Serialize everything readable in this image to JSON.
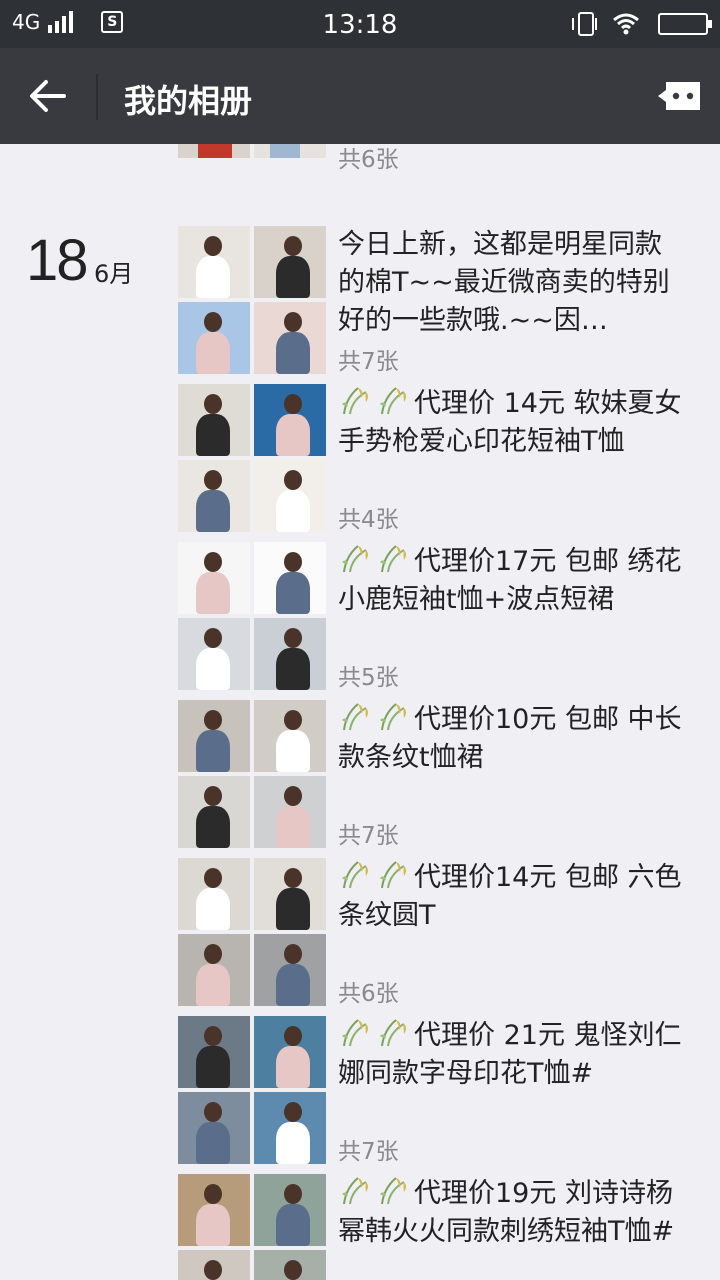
{
  "status_bar": {
    "network": "4G",
    "time": "13:18",
    "sim_badge": "S"
  },
  "app_bar": {
    "title": "我的相册",
    "back_icon": "arrow-left-icon",
    "more_icon": "message-dots-icon"
  },
  "partial_top_post": {
    "count": "共6张"
  },
  "date_group": {
    "day": "18",
    "month": "6月"
  },
  "posts": [
    {
      "caption": "今日上新，这都是明星同款的棉T~~最近微商卖的特别好的一些款哦.~~因…",
      "count": "共7张",
      "has_leaf_icons": false,
      "thumb_colors": [
        "#e8e4df",
        "#d9d2cb",
        "#aac6e6",
        "#e9d8d4"
      ]
    },
    {
      "caption": "代理价 14元 软妹夏女手势枪爱心印花短袖T恤",
      "count": "共4张",
      "has_leaf_icons": true,
      "thumb_colors": [
        "#dfdcd6",
        "#2a6aa5",
        "#eae7e2",
        "#f2efeb"
      ]
    },
    {
      "caption": "代理价17元 包邮 绣花小鹿短袖t恤+波点短裙",
      "count": "共5张",
      "has_leaf_icons": true,
      "thumb_colors": [
        "#f6f6f6",
        "#fbfbfb",
        "#d7dade",
        "#c9cfd5"
      ]
    },
    {
      "caption": "代理价10元 包邮 中长款条纹t恤裙",
      "count": "共7张",
      "has_leaf_icons": true,
      "thumb_colors": [
        "#c7c2bc",
        "#d2ccc6",
        "#d9d7d3",
        "#cfd0d2"
      ]
    },
    {
      "caption": "代理价14元 包邮 六色条纹圆T",
      "count": "共6张",
      "has_leaf_icons": true,
      "thumb_colors": [
        "#dcd9d3",
        "#e1ded8",
        "#b8b5b0",
        "#9fa1a2"
      ]
    },
    {
      "caption": "代理价 21元 鬼怪刘仁娜同款字母印花T恤#",
      "count": "共7张",
      "has_leaf_icons": true,
      "thumb_colors": [
        "#6b7a86",
        "#4c7fa0",
        "#7d8d9d",
        "#5d8bb0"
      ]
    },
    {
      "caption": "代理价19元 刘诗诗杨幂韩火火同款刺绣短袖T恤#",
      "count": "",
      "has_leaf_icons": true,
      "thumb_colors": [
        "#b79c7b",
        "#8fa39a",
        "#cfc8c0",
        "#a6b0a9"
      ]
    }
  ],
  "colors": {
    "status_bar": "#2e3236",
    "app_bar": "#393a3f",
    "background": "#efeff4",
    "count_text": "#8a8a8a"
  }
}
